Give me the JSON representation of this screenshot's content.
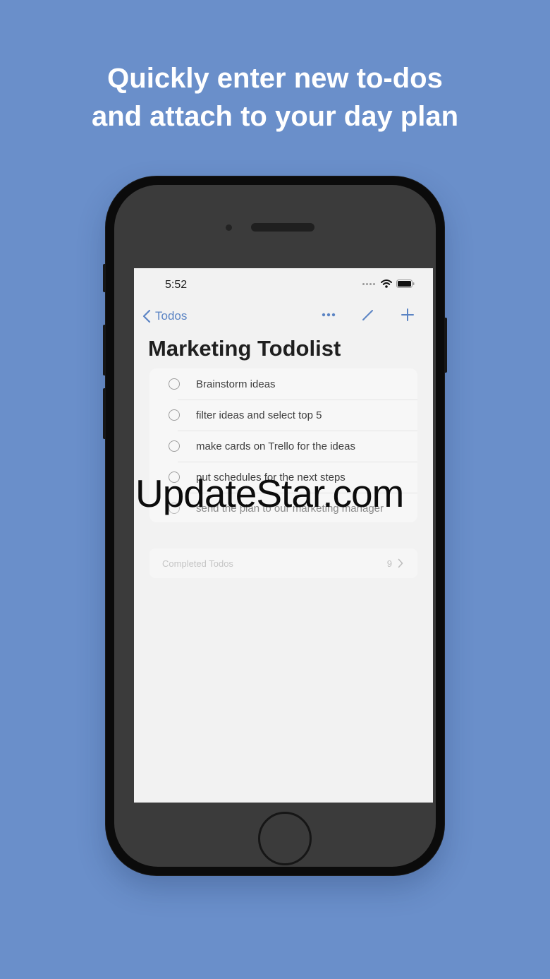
{
  "headline": {
    "line1": "Quickly enter new to-dos",
    "line2": "and attach to your day plan"
  },
  "status_bar": {
    "time": "5:52",
    "icons": [
      "signal-dots-icon",
      "wifi-icon",
      "battery-icon"
    ]
  },
  "nav": {
    "back_label": "Todos",
    "actions": [
      "more-icon",
      "edit-pencil-icon",
      "add-plus-icon"
    ],
    "accent_color": "#5b84c4"
  },
  "page_title": "Marketing Todolist",
  "todos": [
    {
      "label": "Brainstorm ideas"
    },
    {
      "label": "filter ideas and select top 5"
    },
    {
      "label": "make cards on Trello for the ideas"
    },
    {
      "label": "put schedules for the next steps"
    },
    {
      "label": "send the plan to our marketing manager"
    }
  ],
  "completed": {
    "label": "Completed Todos",
    "count": "9"
  },
  "watermark": "UpdateStar.com",
  "colors": {
    "background": "#6a8fca",
    "phone_body": "#3b3b3b",
    "screen": "#f2f2f2"
  }
}
